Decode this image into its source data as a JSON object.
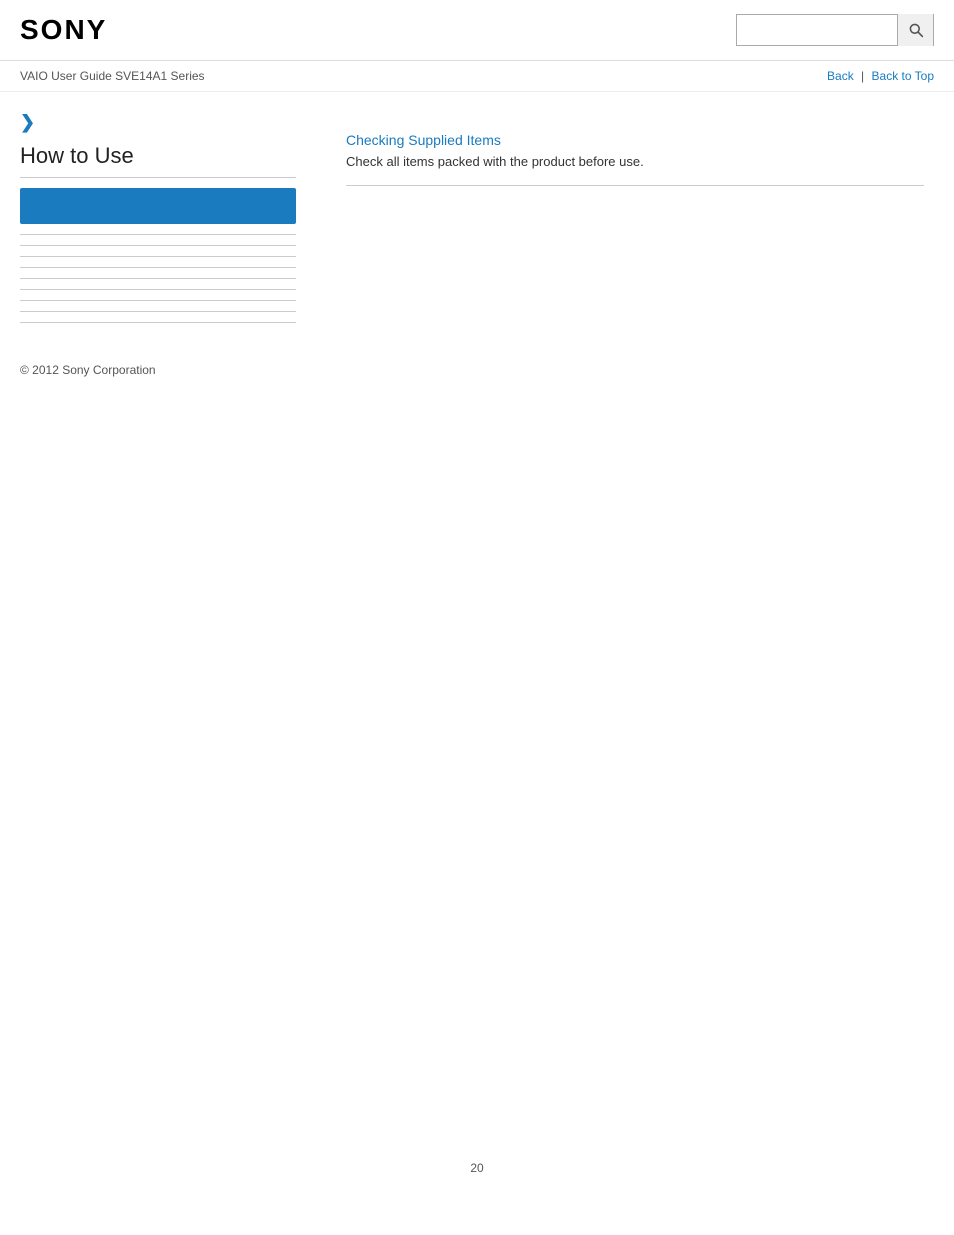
{
  "header": {
    "logo": "SONY",
    "search_placeholder": ""
  },
  "nav": {
    "title": "VAIO User Guide SVE14A1 Series",
    "back_label": "Back",
    "separator": "|",
    "back_to_top_label": "Back to Top"
  },
  "sidebar": {
    "chevron": "❯",
    "section_title": "How to Use",
    "active_item_label": "",
    "lines": [
      1,
      2,
      3,
      4,
      5,
      6,
      7,
      8,
      9
    ],
    "copyright": "© 2012 Sony Corporation"
  },
  "content": {
    "link_text": "Checking Supplied Items",
    "description": "Check all items packed with the product before use."
  },
  "footer": {
    "page_number": "20"
  }
}
